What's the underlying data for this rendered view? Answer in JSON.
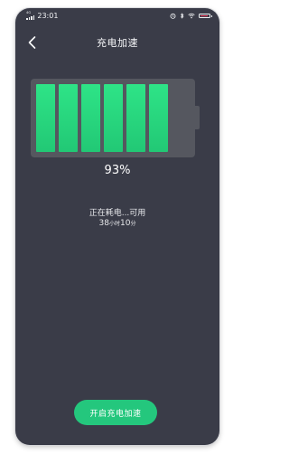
{
  "status_bar": {
    "time": "23:01",
    "signal_label": "4G",
    "right_icons": [
      "alarm-icon",
      "bluetooth-icon",
      "wifi-icon"
    ],
    "battery_level": 0.93,
    "battery_color": "#ff4d6a"
  },
  "header": {
    "title": "充电加速"
  },
  "battery": {
    "percent": "93%",
    "segments_filled": 6,
    "fill_color": "#2ee487"
  },
  "charging": {
    "status": "正在耗电...可用",
    "hours": "38",
    "hours_unit": "小时",
    "minutes": "10",
    "minutes_unit": "分"
  },
  "action": {
    "label": "开启充电加速",
    "color": "#24c77d"
  },
  "theme": {
    "background": "#3a3c48",
    "battery_shell": "#55575f"
  }
}
